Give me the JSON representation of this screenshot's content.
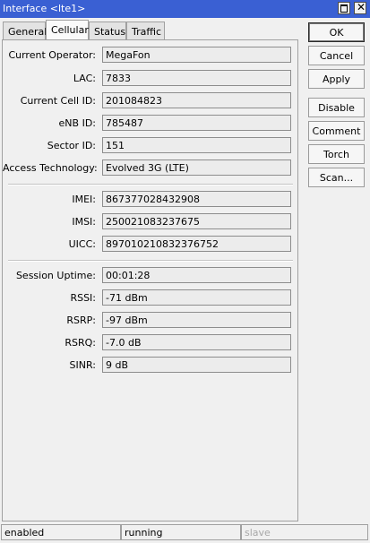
{
  "window": {
    "title": "Interface <lte1>"
  },
  "tabs": [
    {
      "label": "General"
    },
    {
      "label": "Cellular"
    },
    {
      "label": "Status"
    },
    {
      "label": "Traffic"
    }
  ],
  "fields": {
    "current_operator": {
      "label": "Current Operator:",
      "value": "MegaFon"
    },
    "lac": {
      "label": "LAC:",
      "value": "7833"
    },
    "current_cell_id": {
      "label": "Current Cell ID:",
      "value": "201084823"
    },
    "enb_id": {
      "label": "eNB ID:",
      "value": "785487"
    },
    "sector_id": {
      "label": "Sector ID:",
      "value": "151"
    },
    "access_technology": {
      "label": "Access Technology:",
      "value": "Evolved 3G (LTE)"
    },
    "imei": {
      "label": "IMEI:",
      "value": "867377028432908"
    },
    "imsi": {
      "label": "IMSI:",
      "value": "250021083237675"
    },
    "uicc": {
      "label": "UICC:",
      "value": "897010210832376752"
    },
    "session_uptime": {
      "label": "Session Uptime:",
      "value": "00:01:28"
    },
    "rssi": {
      "label": "RSSI:",
      "value": "-71 dBm"
    },
    "rsrp": {
      "label": "RSRP:",
      "value": "-97 dBm"
    },
    "rsrq": {
      "label": "RSRQ:",
      "value": "-7.0 dB"
    },
    "sinr": {
      "label": "SINR:",
      "value": "9 dB"
    }
  },
  "buttons": {
    "ok": "OK",
    "cancel": "Cancel",
    "apply": "Apply",
    "disable": "Disable",
    "comment": "Comment",
    "torch": "Torch",
    "scan": "Scan..."
  },
  "statusbar": {
    "enabled": "enabled",
    "running": "running",
    "slave": "slave"
  },
  "colors": {
    "titlebar": "#3a60d3"
  }
}
